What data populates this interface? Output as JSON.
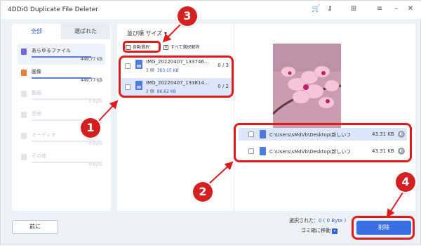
{
  "app": {
    "title": "4DDiG Duplicate File Deleter"
  },
  "window_controls": [
    "cart-icon",
    "key-icon",
    "grid-icon",
    "menu-icon",
    "minimize-icon",
    "close-icon"
  ],
  "tabs": {
    "all": "全部",
    "selected": "選ばれた"
  },
  "categories": [
    {
      "name": "あらゆるファイル",
      "size": "449.77 KB",
      "fill": 0.85,
      "enabled": true,
      "selected": true,
      "icon": "folder-icon",
      "color": "#7a63e0"
    },
    {
      "name": "画像",
      "size": "449.77 KB",
      "fill": 0.85,
      "enabled": true,
      "selected": false,
      "icon": "image-icon",
      "color": "#f07c3c"
    },
    {
      "name": "動画",
      "size": "0 Byte",
      "fill": 0,
      "enabled": false,
      "selected": false,
      "icon": "video-icon",
      "color": "#e1e4ea"
    },
    {
      "name": "音频",
      "size": "0 Byte",
      "fill": 0,
      "enabled": false,
      "selected": false,
      "icon": "audio-icon",
      "color": "#e1e4ea"
    },
    {
      "name": "オーディオ",
      "size": "0 Byte",
      "fill": 0,
      "enabled": false,
      "selected": false,
      "icon": "audio-file-icon",
      "color": "#e1e4ea"
    },
    {
      "name": "その他",
      "size": "0 Byte",
      "fill": 0,
      "enabled": false,
      "selected": false,
      "icon": "other-icon",
      "color": "#e1e4ea"
    }
  ],
  "middle": {
    "sort_label": "並び順 サイズ ▾",
    "auto_select": "自動選択",
    "clear_select": "すべて選択解除",
    "groups": [
      {
        "name": "IMG_20220407_133746...",
        "count_text": "3 個",
        "size": "363.15 KB",
        "ratio": "0 / 3"
      },
      {
        "name": "IMG_20220407_133814...",
        "count_text": "2 個",
        "size": "86.62 KB",
        "ratio": "0 / 2"
      }
    ]
  },
  "right": {
    "files": [
      {
        "path": "C:\\Users\\sMdVb\\Desktop\\新しいフォ...",
        "size": "43.31 KB"
      },
      {
        "path": "C:\\Users\\sMdVb\\Desktop\\新しいフォ...",
        "size": "43.31 KB"
      }
    ]
  },
  "bottom": {
    "prev": "前に",
    "selected_label": "選択された：",
    "selected_value": "0 ( 0 Byte )",
    "trash": "ゴミ箱に移動",
    "delete": "削除"
  },
  "annotations": {
    "b1": "1",
    "b2": "2",
    "b3": "3",
    "b4": "4",
    "accent": "#e01b1b"
  }
}
